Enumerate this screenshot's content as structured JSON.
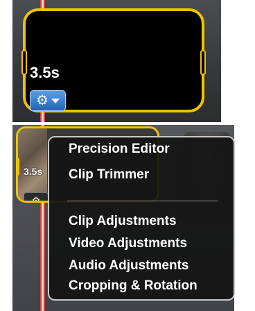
{
  "top_clip": {
    "duration": "3.5s",
    "gear_icon": "gear-icon",
    "menu_caret_icon": "chevron-down-icon"
  },
  "bottom_clip": {
    "duration": "3.5s",
    "gear_icon": "gear-icon"
  },
  "context_menu": {
    "items": [
      "Precision Editor",
      "Clip Trimmer",
      "Clip Adjustments",
      "Video Adjustments",
      "Audio Adjustments",
      "Cropping & Rotation"
    ]
  },
  "colors": {
    "selection": "#f2c200",
    "button_blue": "#2e74d0",
    "playhead_red": "#d0453b"
  }
}
